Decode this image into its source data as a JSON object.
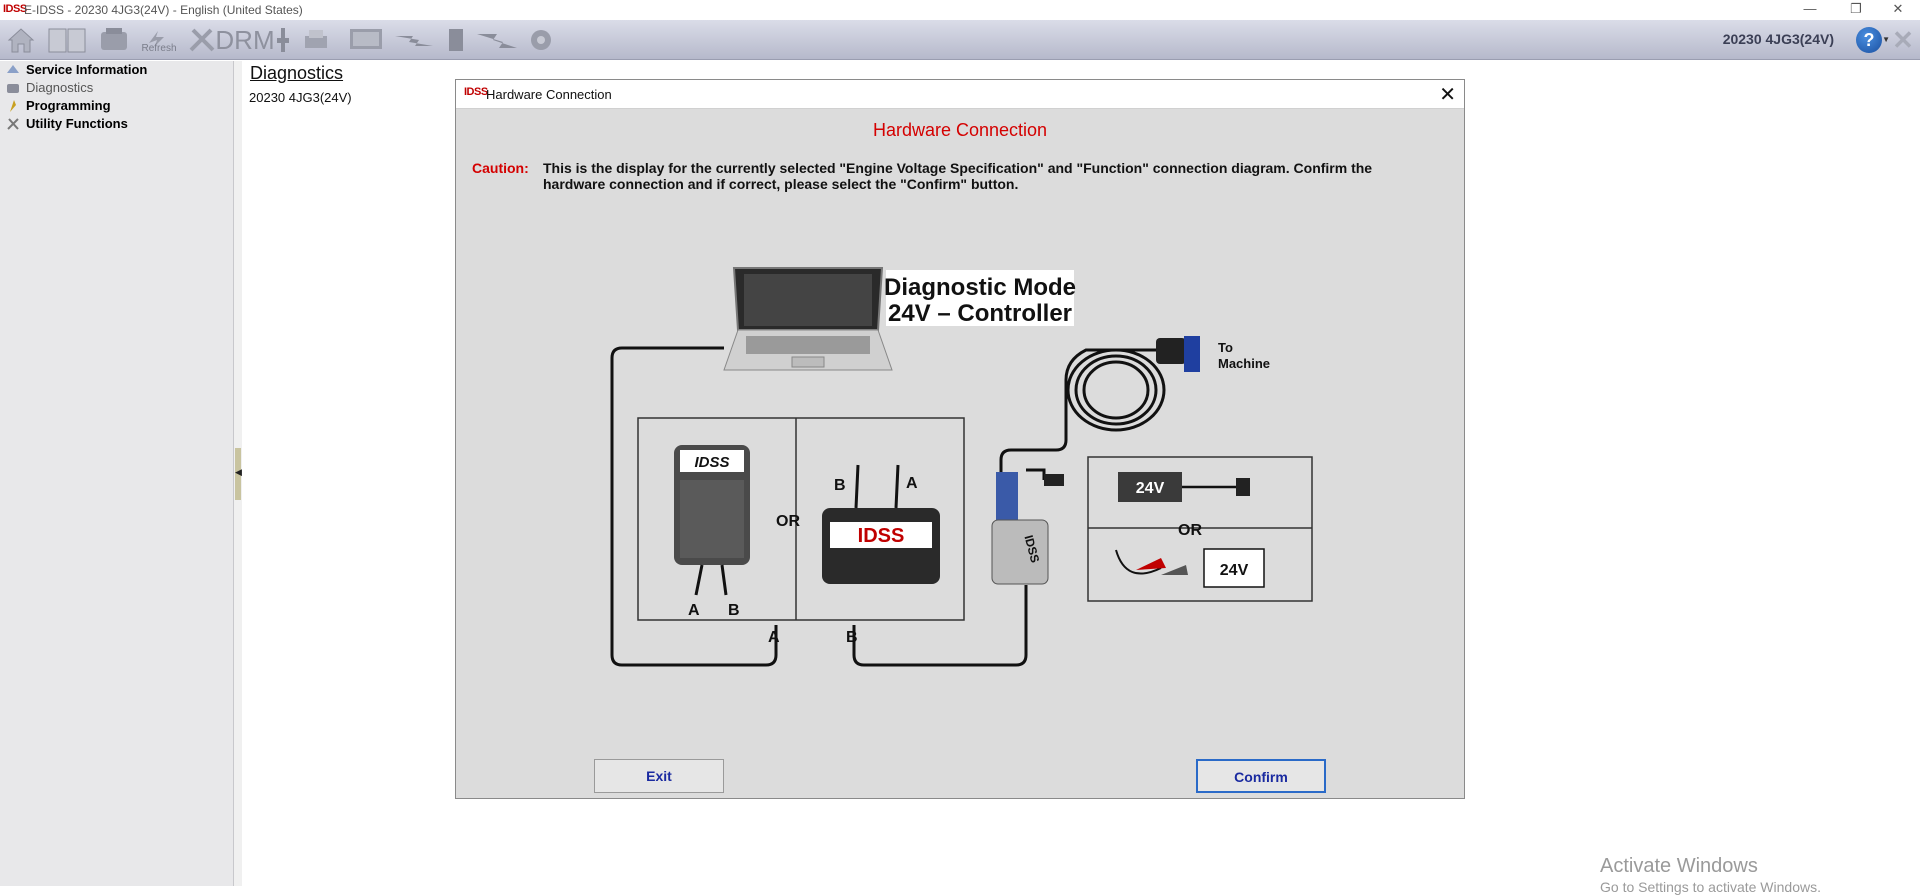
{
  "window": {
    "logo": "IDSS",
    "title": "E-IDSS - 20230 4JG3(24V)  - English (United States)",
    "minimize": "—",
    "restore": "❐",
    "close": "✕"
  },
  "toolbar": {
    "icons": [
      "home-icon",
      "book-icon",
      "engine-icon",
      "refresh-icon",
      "tools-icon",
      "drm-icon",
      "pin-icon",
      "printer-icon",
      "monitor-icon",
      "lightning-icon",
      "phone-icon",
      "flash-icon",
      "gear-icon"
    ],
    "refresh_label": "Refresh",
    "drm_label": "DRM",
    "model": "20230 4JG3(24V)",
    "help": "?"
  },
  "sidebar": {
    "items": [
      {
        "label": "Service Information",
        "icon": "service-info-icon"
      },
      {
        "label": "Diagnostics",
        "icon": "diagnostics-icon"
      },
      {
        "label": "Programming",
        "icon": "programming-icon"
      },
      {
        "label": "Utility Functions",
        "icon": "utility-icon"
      }
    ]
  },
  "main": {
    "heading": "Diagnostics",
    "model": "20230 4JG3(24V)"
  },
  "dialog": {
    "logo": "IDSS",
    "title": "Hardware Connection",
    "heading": "Hardware Connection",
    "caution_label": "Caution:",
    "caution_text": "This is the display for the currently selected \"Engine Voltage Specification\" and \"Function\" connection diagram.  Confirm the hardware connection and if correct, please select the \"Confirm\" button.",
    "exit_label": "Exit",
    "confirm_label": "Confirm",
    "diagram": {
      "title_line1": "Diagnostic Mode",
      "title_line2": "24V – Controller",
      "to_machine_line1": "To",
      "to_machine_line2": "Machine",
      "or": "OR",
      "a": "A",
      "b": "B",
      "voltage": "24V",
      "idss": "IDSS",
      "idss_v": "IDSS"
    }
  },
  "watermark": {
    "line1": "Activate Windows",
    "line2": "Go to Settings to activate Windows."
  }
}
